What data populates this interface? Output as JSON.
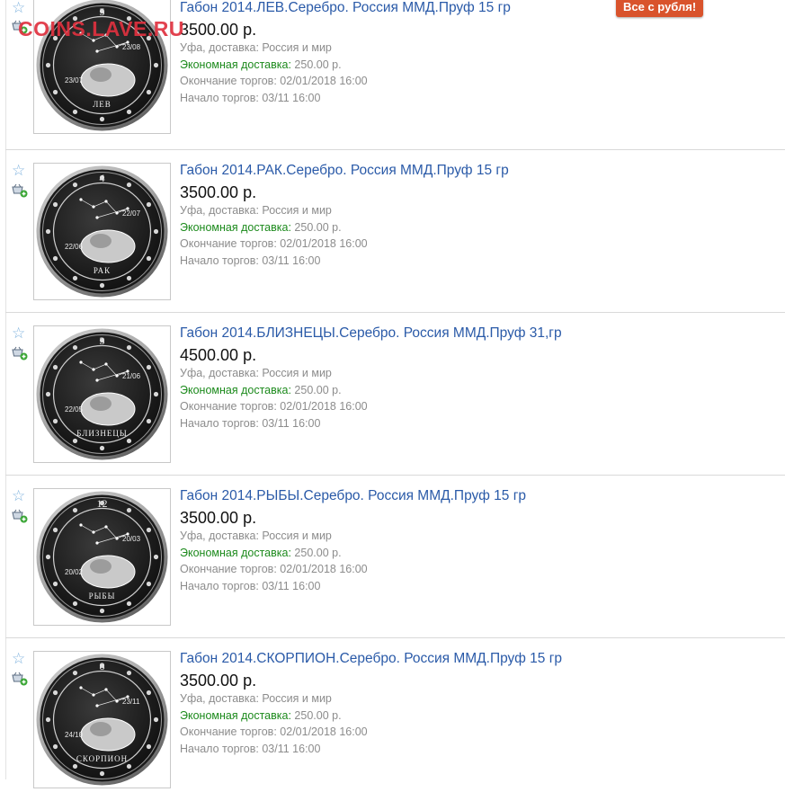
{
  "watermark": "COINS.LAVE.RU",
  "badge": {
    "label": "Все с рубля!"
  },
  "listings": [
    {
      "title": "Габон 2014.ЛЕВ.Серебро. Россия ММД.Пруф 15 гр",
      "price": "3500.00 р.",
      "location": "Уфа, доставка: Россия и мир",
      "delivery_label": "Экономная доставка:",
      "delivery_price": "250.00 р.",
      "end_label": "Окончание торгов:",
      "end_time": "02/01/2018 16:00",
      "start_label": "Начало торгов:",
      "start_time": "03/11 16:00",
      "coin": {
        "number": "5",
        "name": "ЛЕВ",
        "date_left": "23/07",
        "date_right": "23/08"
      }
    },
    {
      "title": "Габон 2014.РАК.Серебро. Россия ММД.Пруф 15 гр",
      "price": "3500.00 р.",
      "location": "Уфа, доставка: Россия и мир",
      "delivery_label": "Экономная доставка:",
      "delivery_price": "250.00 р.",
      "end_label": "Окончание торгов:",
      "end_time": "02/01/2018 16:00",
      "start_label": "Начало торгов:",
      "start_time": "03/11 16:00",
      "coin": {
        "number": "4",
        "name": "РАК",
        "date_left": "22/06",
        "date_right": "22/07"
      }
    },
    {
      "title": "Габон 2014.БЛИЗНЕЦЫ.Серебро. Россия ММД.Пруф 31,гр",
      "price": "4500.00 р.",
      "location": "Уфа, доставка: Россия и мир",
      "delivery_label": "Экономная доставка:",
      "delivery_price": "250.00 р.",
      "end_label": "Окончание торгов:",
      "end_time": "02/01/2018 16:00",
      "start_label": "Начало торгов:",
      "start_time": "03/11 16:00",
      "coin": {
        "number": "3",
        "name": "БЛИЗНЕЦЫ",
        "date_left": "22/05",
        "date_right": "21/06"
      }
    },
    {
      "title": "Габон 2014.РЫБЫ.Серебро. Россия ММД.Пруф 15 гр",
      "price": "3500.00 р.",
      "location": "Уфа, доставка: Россия и мир",
      "delivery_label": "Экономная доставка:",
      "delivery_price": "250.00 р.",
      "end_label": "Окончание торгов:",
      "end_time": "02/01/2018 16:00",
      "start_label": "Начало торгов:",
      "start_time": "03/11 16:00",
      "coin": {
        "number": "12",
        "name": "РЫБЫ",
        "date_left": "20/02",
        "date_right": "20/03"
      }
    },
    {
      "title": "Габон 2014.СКОРПИОН.Серебро. Россия ММД.Пруф 15 гр",
      "price": "3500.00 р.",
      "location": "Уфа, доставка: Россия и мир",
      "delivery_label": "Экономная доставка:",
      "delivery_price": "250.00 р.",
      "end_label": "Окончание торгов:",
      "end_time": "02/01/2018 16:00",
      "start_label": "Начало торгов:",
      "start_time": "03/11 16:00",
      "coin": {
        "number": "8",
        "name": "СКОРПИОН",
        "date_left": "24/10",
        "date_right": "23/11"
      }
    }
  ]
}
